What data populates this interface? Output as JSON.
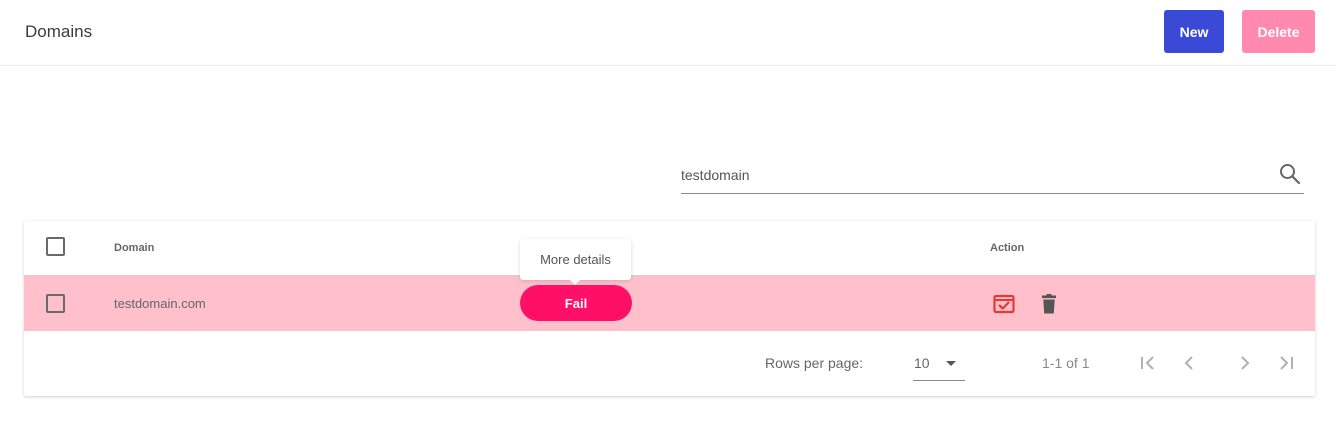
{
  "header": {
    "title": "Domains",
    "new_label": "New",
    "delete_label": "Delete"
  },
  "search": {
    "value": "testdomain",
    "icon": "search-icon"
  },
  "table": {
    "columns": {
      "domain": "Domain",
      "action": "Action"
    },
    "rows": [
      {
        "domain": "testdomain.com",
        "status": "Fail",
        "selected": false,
        "actions": [
          "verify-icon",
          "delete-icon"
        ]
      }
    ],
    "tooltip": "More details"
  },
  "pagination": {
    "rows_per_page_label": "Rows per page:",
    "rows_per_page": "10",
    "range": "1-1 of 1"
  },
  "colors": {
    "primary": "#3b4ad6",
    "delete_button": "#ff8aae",
    "row_highlight": "#ffc0cb",
    "status_fail": "#ff0f65",
    "verify_icon": "#e53935"
  }
}
